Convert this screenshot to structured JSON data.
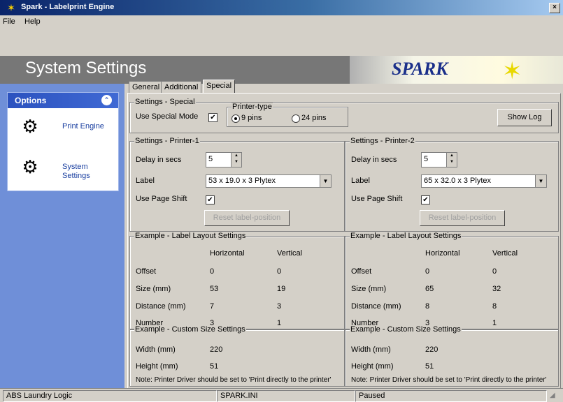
{
  "window": {
    "title": "Spark - Labelprint Engine",
    "close": "×"
  },
  "menu": {
    "file": "File",
    "help": "Help"
  },
  "header": {
    "title": "System Settings",
    "logo": "SPARK"
  },
  "sidebar": {
    "panel_title": "Options",
    "collapse": "⌃",
    "items": [
      {
        "label": "Print Engine"
      },
      {
        "label": "System Settings"
      }
    ]
  },
  "tabs": [
    "General",
    "Additional",
    "Special"
  ],
  "special": {
    "group_label": "Settings - Special",
    "use_special_mode": "Use Special Mode",
    "use_special_mode_checked": true,
    "printer_type_label": "Printer-type",
    "option_9": "9 pins",
    "option_24": "24 pins",
    "selected": "9 pins",
    "show_log": "Show Log"
  },
  "printers": [
    {
      "group_label": "Settings - Printer-1",
      "delay_label": "Delay in secs",
      "delay_value": "5",
      "label_label": "Label",
      "label_value": "53 x 19.0 x 3 Plytex",
      "page_shift_label": "Use Page Shift",
      "page_shift_checked": true,
      "reset_button": "Reset label-position",
      "layout_label": "Example - Label Layout Settings",
      "col_h": "Horizontal",
      "col_v": "Vertical",
      "rows": [
        {
          "name": "Offset",
          "h": "0",
          "v": "0"
        },
        {
          "name": "Size (mm)",
          "h": "53",
          "v": "19"
        },
        {
          "name": "Distance (mm)",
          "h": "7",
          "v": "3"
        },
        {
          "name": "Number",
          "h": "3",
          "v": "1"
        }
      ],
      "custom_label": "Example - Custom Size Settings",
      "width_label": "Width (mm)",
      "width_value": "220",
      "height_label": "Height (mm)",
      "height_value": "51",
      "note": "Note: Printer Driver should be set to 'Print directly to the printer'"
    },
    {
      "group_label": "Settings - Printer-2",
      "delay_label": "Delay in secs",
      "delay_value": "5",
      "label_label": "Label",
      "label_value": "65 x 32.0 x 3 Plytex",
      "page_shift_label": "Use Page Shift",
      "page_shift_checked": true,
      "reset_button": "Reset label-position",
      "layout_label": "Example - Label Layout Settings",
      "col_h": "Horizontal",
      "col_v": "Vertical",
      "rows": [
        {
          "name": "Offset",
          "h": "0",
          "v": "0"
        },
        {
          "name": "Size (mm)",
          "h": "65",
          "v": "32"
        },
        {
          "name": "Distance (mm)",
          "h": "8",
          "v": "8"
        },
        {
          "name": "Number",
          "h": "3",
          "v": "1"
        }
      ],
      "custom_label": "Example - Custom Size Settings",
      "width_label": "Width (mm)",
      "width_value": "220",
      "height_label": "Height (mm)",
      "height_value": "51",
      "note": "Note: Printer Driver should be set to 'Print directly to the printer'"
    }
  ],
  "status": {
    "left": "ABS Laundry Logic",
    "middle": "SPARK.INI",
    "right": "Paused"
  }
}
